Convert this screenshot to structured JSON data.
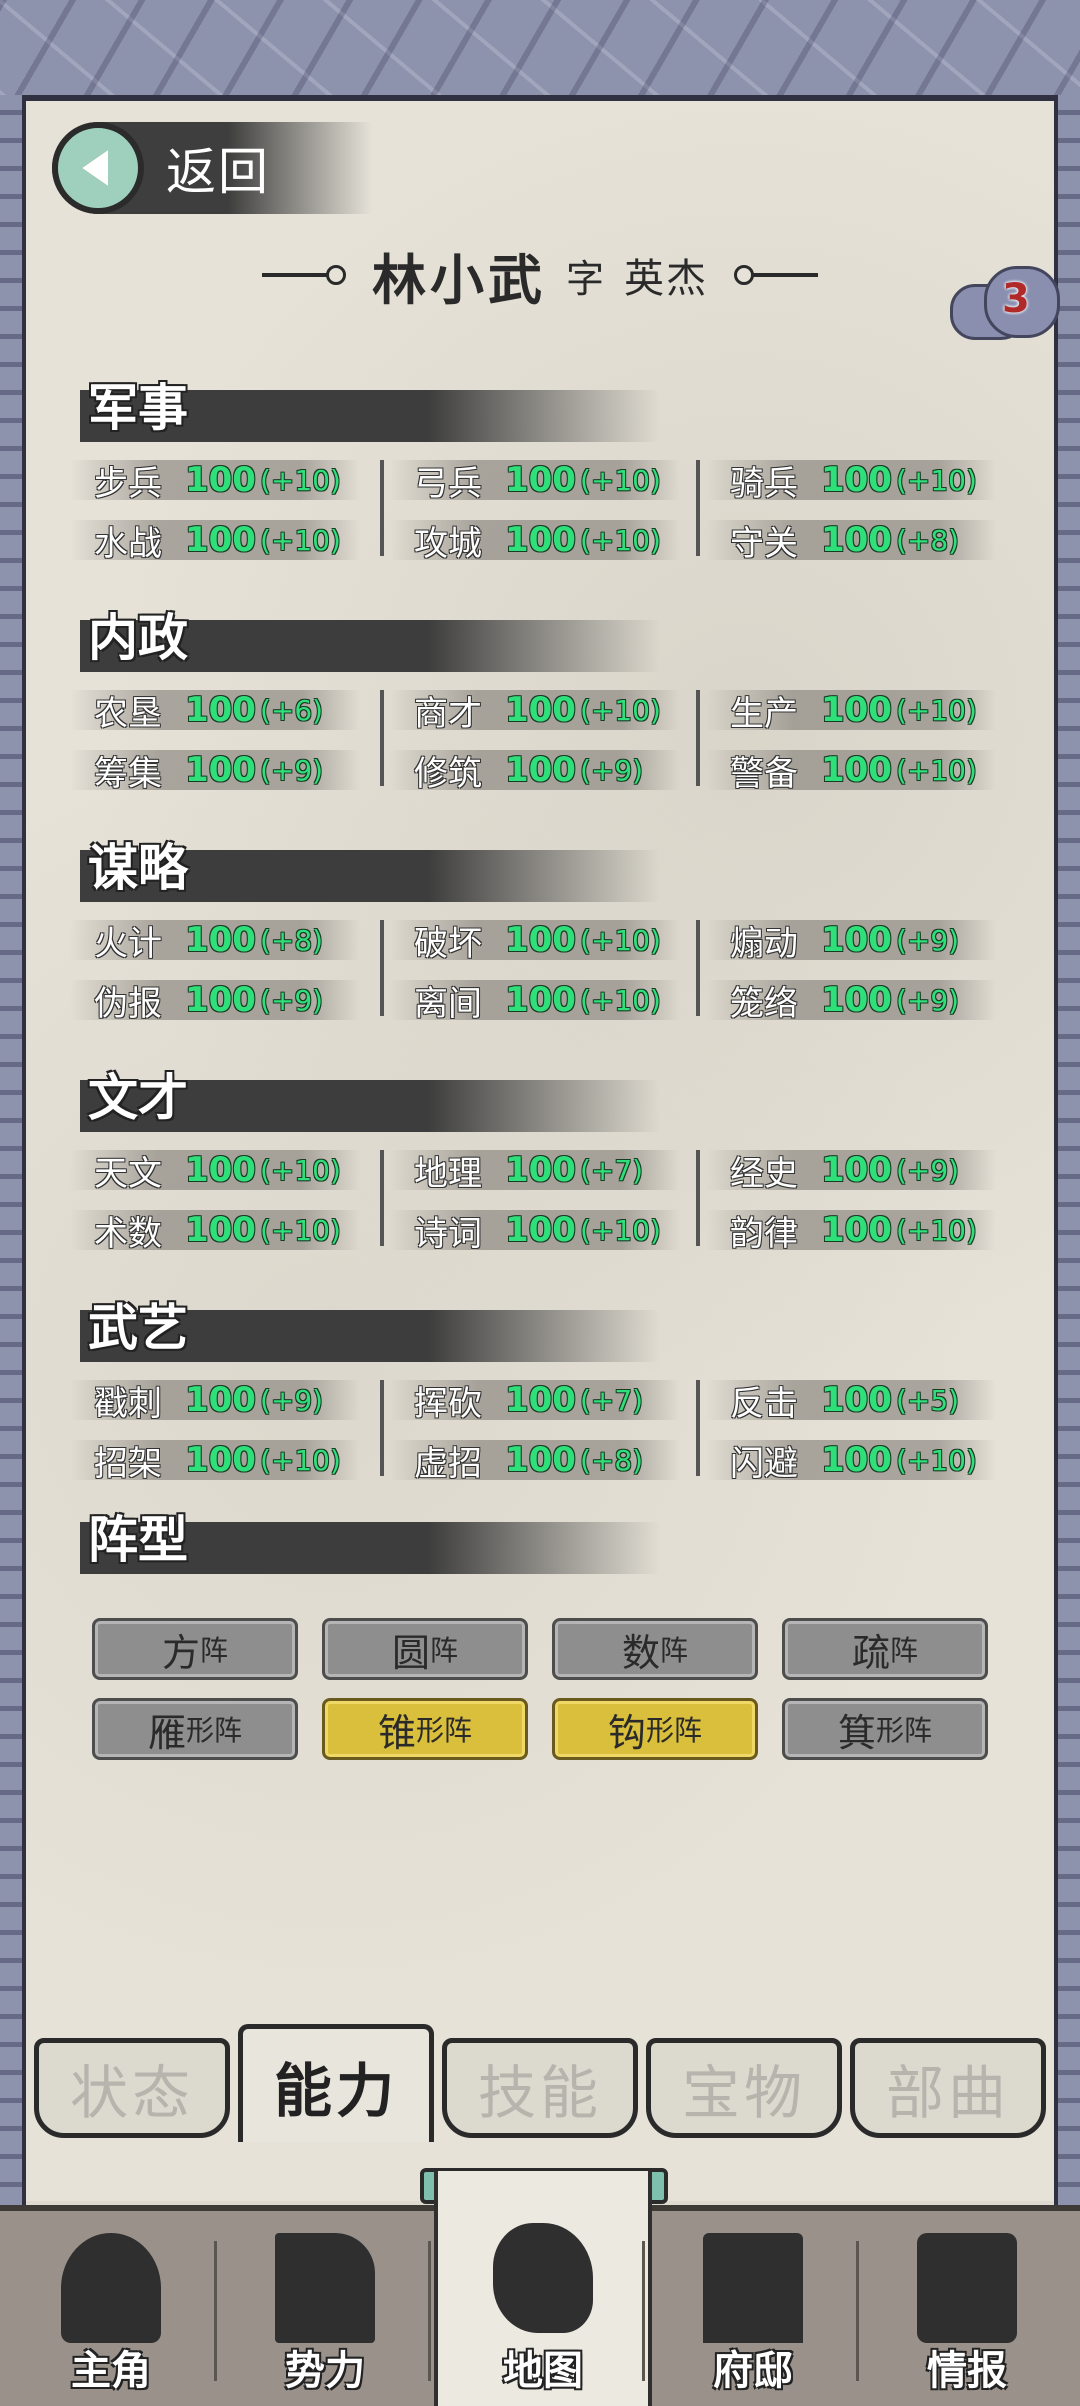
{
  "back_label": "返回",
  "character": {
    "name": "林小武",
    "zi_label": "字",
    "style_name": "英杰"
  },
  "badge_count": "3",
  "sections": [
    {
      "title": "军事",
      "stats": [
        {
          "label": "步兵",
          "value": "100",
          "bonus": "(+10)"
        },
        {
          "label": "弓兵",
          "value": "100",
          "bonus": "(+10)"
        },
        {
          "label": "骑兵",
          "value": "100",
          "bonus": "(+10)"
        },
        {
          "label": "水战",
          "value": "100",
          "bonus": "(+10)"
        },
        {
          "label": "攻城",
          "value": "100",
          "bonus": "(+10)"
        },
        {
          "label": "守关",
          "value": "100",
          "bonus": "(+8)"
        }
      ]
    },
    {
      "title": "内政",
      "stats": [
        {
          "label": "农垦",
          "value": "100",
          "bonus": "(+6)"
        },
        {
          "label": "商才",
          "value": "100",
          "bonus": "(+10)"
        },
        {
          "label": "生产",
          "value": "100",
          "bonus": "(+10)"
        },
        {
          "label": "筹集",
          "value": "100",
          "bonus": "(+9)"
        },
        {
          "label": "修筑",
          "value": "100",
          "bonus": "(+9)"
        },
        {
          "label": "警备",
          "value": "100",
          "bonus": "(+10)"
        }
      ]
    },
    {
      "title": "谋略",
      "stats": [
        {
          "label": "火计",
          "value": "100",
          "bonus": "(+8)"
        },
        {
          "label": "破坏",
          "value": "100",
          "bonus": "(+10)"
        },
        {
          "label": "煽动",
          "value": "100",
          "bonus": "(+9)"
        },
        {
          "label": "伪报",
          "value": "100",
          "bonus": "(+9)"
        },
        {
          "label": "离间",
          "value": "100",
          "bonus": "(+10)"
        },
        {
          "label": "笼络",
          "value": "100",
          "bonus": "(+9)"
        }
      ]
    },
    {
      "title": "文才",
      "stats": [
        {
          "label": "天文",
          "value": "100",
          "bonus": "(+10)"
        },
        {
          "label": "地理",
          "value": "100",
          "bonus": "(+7)"
        },
        {
          "label": "经史",
          "value": "100",
          "bonus": "(+9)"
        },
        {
          "label": "术数",
          "value": "100",
          "bonus": "(+10)"
        },
        {
          "label": "诗词",
          "value": "100",
          "bonus": "(+10)"
        },
        {
          "label": "韵律",
          "value": "100",
          "bonus": "(+10)"
        }
      ]
    },
    {
      "title": "武艺",
      "stats": [
        {
          "label": "戳刺",
          "value": "100",
          "bonus": "(+9)"
        },
        {
          "label": "挥砍",
          "value": "100",
          "bonus": "(+7)"
        },
        {
          "label": "反击",
          "value": "100",
          "bonus": "(+5)"
        },
        {
          "label": "招架",
          "value": "100",
          "bonus": "(+10)"
        },
        {
          "label": "虚招",
          "value": "100",
          "bonus": "(+8)"
        },
        {
          "label": "闪避",
          "value": "100",
          "bonus": "(+10)"
        }
      ]
    }
  ],
  "formation_title": "阵型",
  "formations": [
    {
      "big": "方",
      "small": "阵",
      "active": false
    },
    {
      "big": "圆",
      "small": "阵",
      "active": false
    },
    {
      "big": "数",
      "small": "阵",
      "active": false
    },
    {
      "big": "疏",
      "small": "阵",
      "active": false
    },
    {
      "big": "雁",
      "small": "形阵",
      "active": false
    },
    {
      "big": "锥",
      "small": "形阵",
      "active": true
    },
    {
      "big": "钩",
      "small": "形阵",
      "active": true
    },
    {
      "big": "箕",
      "small": "形阵",
      "active": false
    }
  ],
  "tabs": [
    {
      "label": "状态",
      "active": false
    },
    {
      "label": "能力",
      "active": true
    },
    {
      "label": "技能",
      "active": false
    },
    {
      "label": "宝物",
      "active": false
    },
    {
      "label": "部曲",
      "active": false
    }
  ],
  "nav": [
    {
      "label": "主角",
      "icon": "hero-icon",
      "active": false
    },
    {
      "label": "势力",
      "icon": "flag-icon",
      "active": false
    },
    {
      "label": "地图",
      "icon": "map-icon",
      "active": true
    },
    {
      "label": "府邸",
      "icon": "mansion-icon",
      "active": false
    },
    {
      "label": "情报",
      "icon": "scroll-icon",
      "active": false
    }
  ],
  "colors": {
    "accent_green": "#2fe07a",
    "active_formation": "#d9bf3c",
    "border_blue": "#8d92ad"
  }
}
